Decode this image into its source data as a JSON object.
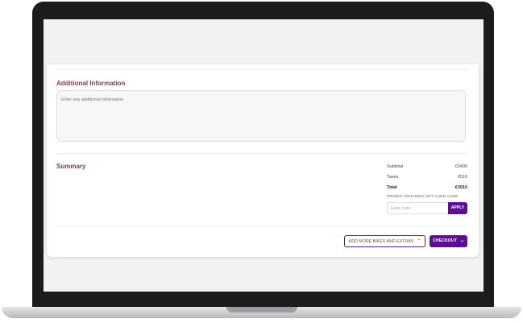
{
  "additional_info": {
    "title": "Additional Information",
    "placeholder": "Enter any additional information"
  },
  "summary": {
    "title": "Summary",
    "rows": [
      {
        "label": "Subtotal",
        "value": "€3400"
      },
      {
        "label": "Taxes",
        "value": "€510"
      },
      {
        "label": "Total",
        "value": "€3910"
      }
    ],
    "promo_label": "PROMO/ VOUCHER/ GIFT CARD CODE",
    "promo_placeholder": "Enter code",
    "apply_label": "APPLY"
  },
  "actions": {
    "add_more_label": "ADD MORE BIKES AND EXTRAS",
    "add_more_icon": "chevron-up-icon",
    "checkout_label": "CHECKOUT",
    "checkout_icon": "chevron-down-icon"
  },
  "colors": {
    "accent": "#5c0f91",
    "title": "#7a3d4c"
  }
}
